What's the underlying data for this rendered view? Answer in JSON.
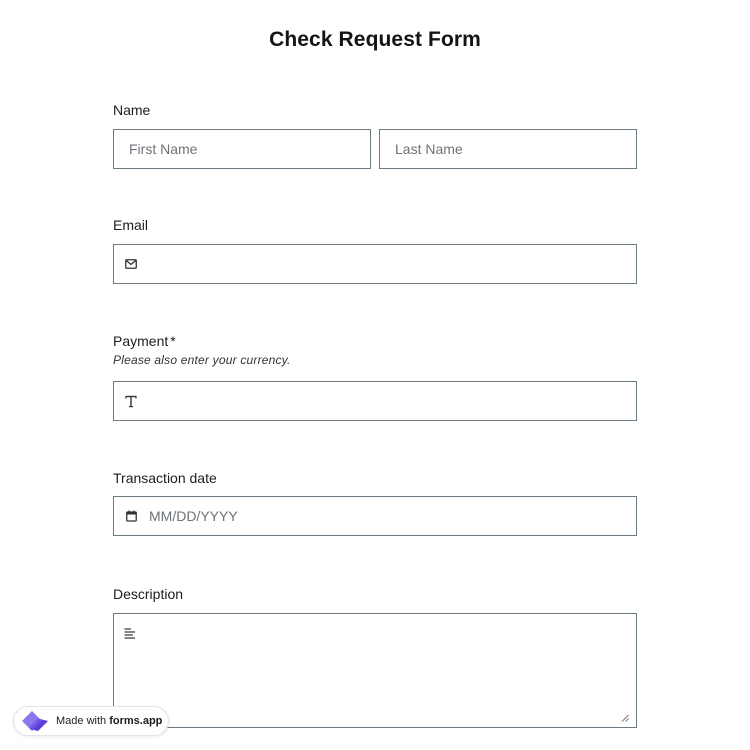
{
  "form": {
    "title": "Check Request Form"
  },
  "name": {
    "label": "Name",
    "first_placeholder": "First Name",
    "last_placeholder": "Last Name"
  },
  "email": {
    "label": "Email",
    "icon": "envelope-icon",
    "value": ""
  },
  "payment": {
    "label": "Payment",
    "required_mark": "*",
    "hint": "Please also enter your currency.",
    "icon": "text-t-icon",
    "value": ""
  },
  "transaction_date": {
    "label": "Transaction date",
    "icon": "calendar-icon",
    "placeholder": "MM/DD/YYYY"
  },
  "description": {
    "label": "Description",
    "icon": "paragraph-lines-icon",
    "value": ""
  },
  "badge": {
    "prefix": "Made with",
    "brand": "forms.app"
  },
  "colors": {
    "border": "#6b7a82",
    "placeholder": "#6e7378",
    "brand_purple": "#6b4fe0"
  }
}
